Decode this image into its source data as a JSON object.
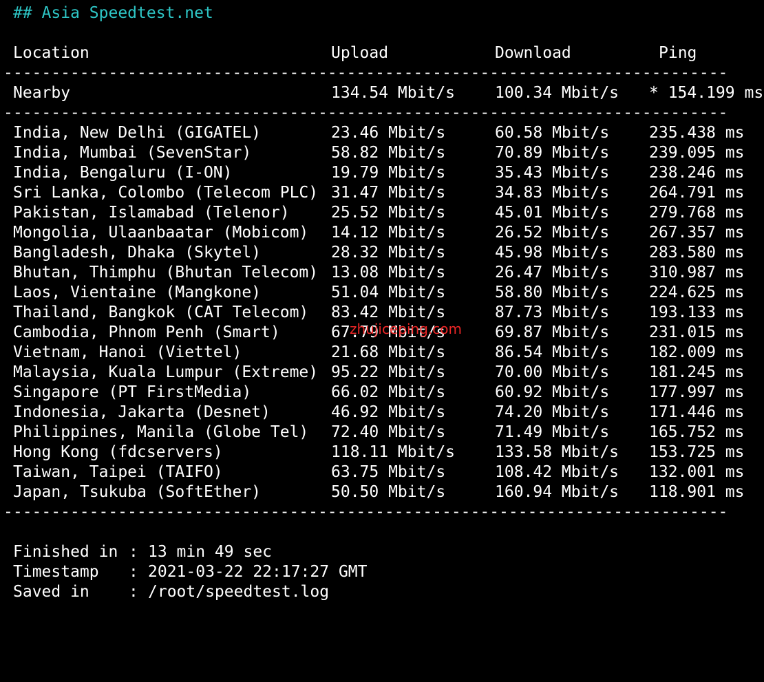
{
  "heading": "## Asia Speedtest.net",
  "columns": {
    "location": "Location",
    "upload": "Upload",
    "download": "Download",
    "ping": "Ping"
  },
  "divider": "-------------------------------------------------------------------------------------------------",
  "nearby": {
    "location": "Nearby",
    "upload": "134.54 Mbit/s",
    "download": "100.34 Mbit/s",
    "ping": "* 154.199 ms"
  },
  "rows": [
    {
      "location": "India, New Delhi (GIGATEL)",
      "upload": "23.46 Mbit/s",
      "download": "60.58 Mbit/s",
      "ping": "235.438 ms"
    },
    {
      "location": "India, Mumbai (SevenStar)",
      "upload": "58.82 Mbit/s",
      "download": "70.89 Mbit/s",
      "ping": "239.095 ms"
    },
    {
      "location": "India, Bengaluru (I-ON)",
      "upload": "19.79 Mbit/s",
      "download": "35.43 Mbit/s",
      "ping": "238.246 ms"
    },
    {
      "location": "Sri Lanka, Colombo (Telecom PLC)",
      "upload": "31.47 Mbit/s",
      "download": "34.83 Mbit/s",
      "ping": "264.791 ms"
    },
    {
      "location": "Pakistan, Islamabad (Telenor)",
      "upload": "25.52 Mbit/s",
      "download": "45.01 Mbit/s",
      "ping": "279.768 ms"
    },
    {
      "location": "Mongolia, Ulaanbaatar (Mobicom)",
      "upload": "14.12 Mbit/s",
      "download": "26.52 Mbit/s",
      "ping": "267.357 ms"
    },
    {
      "location": "Bangladesh, Dhaka (Skytel)",
      "upload": "28.32 Mbit/s",
      "download": "45.98 Mbit/s",
      "ping": "283.580 ms"
    },
    {
      "location": "Bhutan, Thimphu (Bhutan Telecom)",
      "upload": "13.08 Mbit/s",
      "download": "26.47 Mbit/s",
      "ping": "310.987 ms"
    },
    {
      "location": "Laos, Vientaine (Mangkone)",
      "upload": "51.04 Mbit/s",
      "download": "58.80 Mbit/s",
      "ping": "224.625 ms"
    },
    {
      "location": "Thailand, Bangkok (CAT Telecom)",
      "upload": "83.42 Mbit/s",
      "download": "87.73 Mbit/s",
      "ping": "193.133 ms"
    },
    {
      "location": "Cambodia, Phnom Penh (Smart)",
      "upload": "67.79 Mbit/s",
      "download": "69.87 Mbit/s",
      "ping": "231.015 ms"
    },
    {
      "location": "Vietnam, Hanoi (Viettel)",
      "upload": "21.68 Mbit/s",
      "download": "86.54 Mbit/s",
      "ping": "182.009 ms"
    },
    {
      "location": "Malaysia, Kuala Lumpur (Extreme)",
      "upload": "95.22 Mbit/s",
      "download": "70.00 Mbit/s",
      "ping": "181.245 ms"
    },
    {
      "location": "Singapore (PT FirstMedia)",
      "upload": "66.02 Mbit/s",
      "download": "60.92 Mbit/s",
      "ping": "177.997 ms"
    },
    {
      "location": "Indonesia, Jakarta (Desnet)",
      "upload": "46.92 Mbit/s",
      "download": "74.20 Mbit/s",
      "ping": "171.446 ms"
    },
    {
      "location": "Philippines, Manila (Globe Tel)",
      "upload": "72.40 Mbit/s",
      "download": "71.49 Mbit/s",
      "ping": "165.752 ms"
    },
    {
      "location": "Hong Kong (fdcservers)",
      "upload": "118.11 Mbit/s",
      "download": "133.58 Mbit/s",
      "ping": "153.725 ms"
    },
    {
      "location": "Taiwan, Taipei (TAIFO)",
      "upload": "63.75 Mbit/s",
      "download": "108.42 Mbit/s",
      "ping": "132.001 ms"
    },
    {
      "location": "Japan, Tsukuba (SoftEther)",
      "upload": "50.50 Mbit/s",
      "download": "160.94 Mbit/s",
      "ping": "118.901 ms"
    }
  ],
  "watermark": "zhujiceping.com",
  "summary": {
    "finished_label": "Finished in",
    "finished_value": "13 min 49 sec",
    "timestamp_label": "Timestamp",
    "timestamp_value": "2021-03-22 22:17:27 GMT",
    "saved_label": "Saved in",
    "saved_value": "/root/speedtest.log",
    "colon": ":"
  },
  "colors": {
    "background": "#000000",
    "text": "#ffffff",
    "heading": "#2ec6c6",
    "watermark": "#ff2a2a"
  }
}
